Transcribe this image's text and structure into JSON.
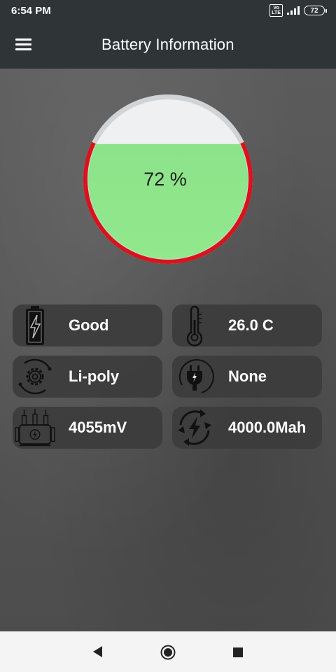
{
  "status_bar": {
    "time": "6:54 PM",
    "volte": "Vo\nLTE",
    "battery_level": "72"
  },
  "app_bar": {
    "title": "Battery Information",
    "menu_icon": "hamburger-menu-icon"
  },
  "gauge": {
    "percent_label": "72 %",
    "level_fraction": 0.72,
    "fill_color": "#8fe58b",
    "ring_color": "#d7141b",
    "empty_color": "#eef0f2"
  },
  "cards": [
    {
      "name": "health",
      "icon": "battery-bolt-icon",
      "value": "Good"
    },
    {
      "name": "temperature",
      "icon": "thermometer-icon",
      "value": "26.0 C"
    },
    {
      "name": "technology",
      "icon": "gear-cycle-icon",
      "value": "Li-poly"
    },
    {
      "name": "plug",
      "icon": "power-plug-icon",
      "value": "None"
    },
    {
      "name": "voltage",
      "icon": "transformer-icon",
      "value": "4055mV"
    },
    {
      "name": "capacity",
      "icon": "charge-cycle-icon",
      "value": "4000.0Mah"
    }
  ],
  "nav_bar": {
    "back_icon": "back-triangle-icon",
    "home_icon": "home-circle-icon",
    "recents_icon": "recents-square-icon"
  }
}
